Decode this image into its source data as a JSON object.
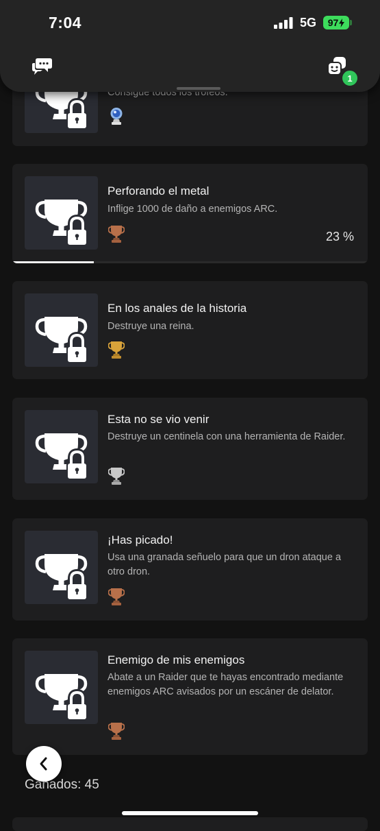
{
  "status_bar": {
    "time": "7:04",
    "network": "5G",
    "battery": "97"
  },
  "header": {
    "party_badge_count": "1"
  },
  "trophies": [
    {
      "title": "",
      "description": "Consigue todos los trofeos.",
      "grade": "platinum",
      "progress": null
    },
    {
      "title": "Perforando el metal",
      "description": "Inflige 1000 de daño a enemigos ARC.",
      "grade": "bronze",
      "progress": "23 %",
      "progress_fraction": 0.23
    },
    {
      "title": "En los anales de la historia",
      "description": "Destruye una reina.",
      "grade": "gold",
      "progress": null
    },
    {
      "title": "Esta no se vio venir",
      "description": "Destruye un centinela con una herramienta de Raider.",
      "grade": "silver",
      "progress": null
    },
    {
      "title": "¡Has picado!",
      "description": "Usa una granada señuelo para que un dron ataque a otro dron.",
      "grade": "bronze",
      "progress": null
    },
    {
      "title": "Enemigo de mis enemigos",
      "description": "Abate a un Raider que te hayas encontrado mediante enemigos ARC avisados por un escáner de delator.",
      "grade": "bronze",
      "progress": null
    }
  ],
  "earned_label": "Ganados: 45",
  "colors": {
    "platinum": "#8fb6e8",
    "gold": "#d9a33a",
    "silver": "#c8c8c8",
    "bronze": "#b8704a",
    "badge": "#30c55a",
    "battery": "#3ddc5c"
  }
}
